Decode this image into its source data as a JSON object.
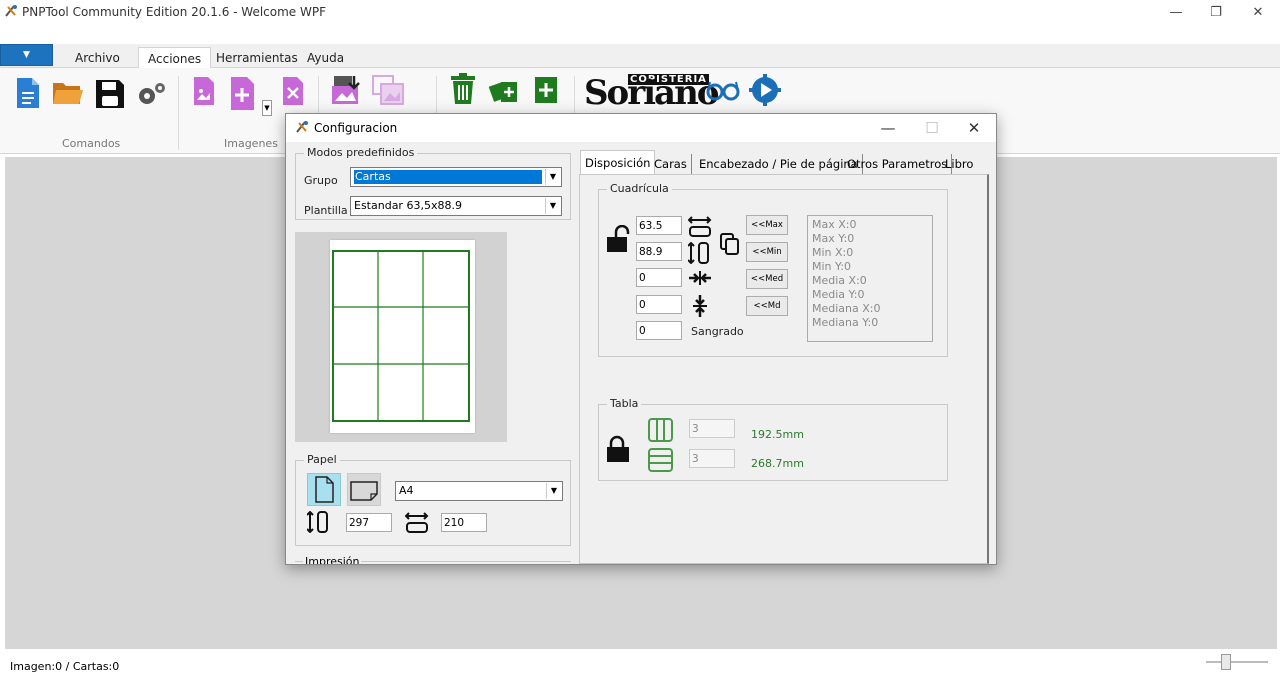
{
  "app": {
    "title": "PNPTool Community Edition 20.1.6 - Welcome WPF"
  },
  "ribbon": {
    "tabs": [
      "Archivo",
      "Acciones",
      "Herramientas",
      "Ayuda"
    ],
    "active_tab": "Acciones",
    "groups": {
      "comandos": "Comandos",
      "imagenes": "Imagenes"
    },
    "logo_top": "COPISTERIA",
    "logo_main": "Soriano"
  },
  "status": {
    "text": "Imagen:0 / Cartas:0"
  },
  "dialog": {
    "title": "Configuracion",
    "modos": {
      "label": "Modos predefinidos",
      "grupo_label": "Grupo",
      "grupo_value": "Cartas",
      "plantilla_label": "Plantilla",
      "plantilla_value": "Estandar 63,5x88.9"
    },
    "papel": {
      "label": "Papel",
      "size": "A4",
      "height": "297",
      "width": "210"
    },
    "impresion_label": "Impresión",
    "tabs": [
      "Disposición",
      "Caras",
      "Encabezado / Pie de página",
      "Otros Parametros",
      "Libro"
    ],
    "active_tab": "Disposición",
    "cuadricula": {
      "label": "Cuadrícula",
      "width": "63.5",
      "height": "88.9",
      "hspace": "0",
      "vspace": "0",
      "bleed": "0",
      "bleed_label": "Sangrado",
      "buttons": [
        "<<Max",
        "<<Min",
        "<<Med",
        "<<Md"
      ],
      "stats": [
        "Max X:0",
        "Max Y:0",
        "Min X:0",
        "Min Y:0",
        "Media X:0",
        "Media Y:0",
        "Mediana X:0",
        "Mediana Y:0"
      ]
    },
    "tabla": {
      "label": "Tabla",
      "cols": "3",
      "rows": "3",
      "width_mm": "192.5mm",
      "height_mm": "268.7mm"
    }
  },
  "colors": {
    "accent": "#0078d7",
    "file_button": "#1e73be",
    "grid_green": "#1e7b1e"
  }
}
